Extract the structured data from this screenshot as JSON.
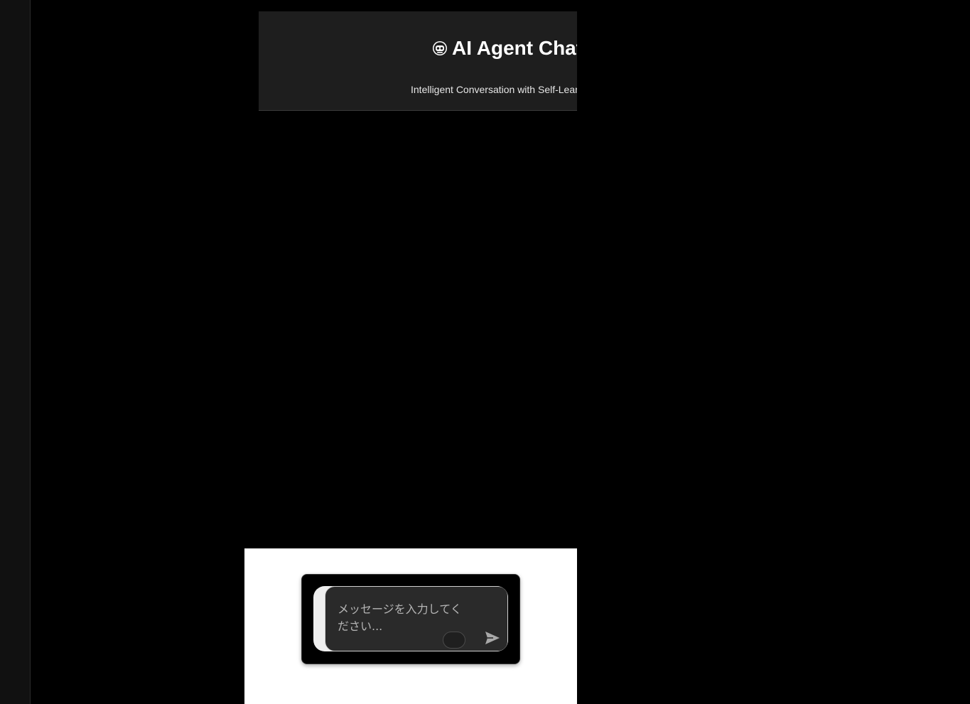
{
  "header": {
    "title": "AI Agent Chat",
    "subtitle": "Intelligent Conversation with Self-Learning",
    "icon": "robot-face-icon"
  },
  "chat_input": {
    "placeholder": "メッセージを入力してください...",
    "send_icon": "send-icon"
  },
  "colors": {
    "page_background": "#000000",
    "sidebar": "#111111",
    "header_background": "#1e1e1e",
    "input_background": "#2a2a2a",
    "placeholder_text": "#b5b5b5",
    "bottom_panel": "#ffffff"
  }
}
